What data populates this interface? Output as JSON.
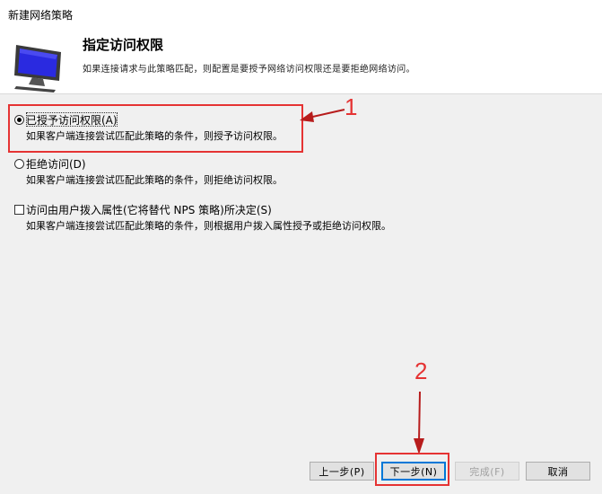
{
  "window": {
    "title": "新建网络策略"
  },
  "header": {
    "heading": "指定访问权限",
    "description": "如果连接请求与此策略匹配，则配置是要授予网络访问权限还是要拒绝网络访问。"
  },
  "options": [
    {
      "label": "已授予访问权限(A)",
      "description": "如果客户端连接尝试匹配此策略的条件，则授予访问权限。",
      "selected": true
    },
    {
      "label": "拒绝访问(D)",
      "description": "如果客户端连接尝试匹配此策略的条件，则拒绝访问权限。",
      "selected": false
    },
    {
      "label": "访问由用户拨入属性(它将替代 NPS 策略)所决定(S)",
      "description": "如果客户端连接尝试匹配此策略的条件，则根据用户拨入属性授予或拒绝访问权限。",
      "checked": false
    }
  ],
  "annotations": {
    "step1": "1",
    "step2": "2",
    "color": "#e53333"
  },
  "buttons": {
    "prev": "上一步(P)",
    "next": "下一步(N)",
    "finish": "完成(F)",
    "cancel": "取消"
  }
}
